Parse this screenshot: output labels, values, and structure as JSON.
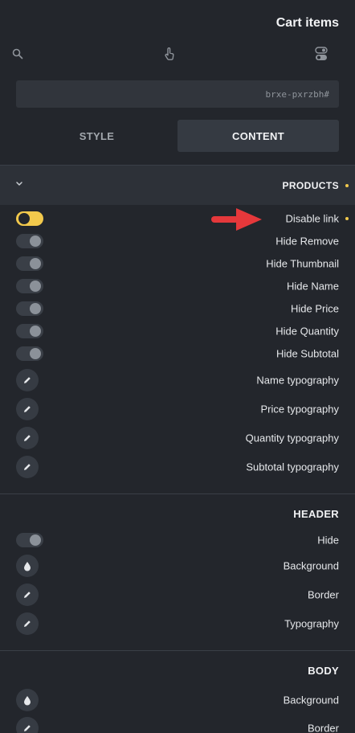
{
  "panel": {
    "title": "Cart items"
  },
  "toolbar": {
    "icons": [
      "search-icon",
      "pointer-icon",
      "toggle-icon"
    ]
  },
  "selector": {
    "value": "brxe-pxrzbh#"
  },
  "tabs": [
    {
      "label": "STYLE",
      "active": false
    },
    {
      "label": "CONTENT",
      "active": true
    }
  ],
  "products": {
    "title": "PRODUCTS",
    "toggles": [
      {
        "label": "Disable link",
        "on": true,
        "modified": true
      },
      {
        "label": "Hide Remove",
        "on": false
      },
      {
        "label": "Hide Thumbnail",
        "on": false
      },
      {
        "label": "Hide Name",
        "on": false
      },
      {
        "label": "Hide Price",
        "on": false
      },
      {
        "label": "Hide Quantity",
        "on": false
      },
      {
        "label": "Hide Subtotal",
        "on": false
      }
    ],
    "typography": [
      {
        "label": "Name typography",
        "icon": "pencil-icon"
      },
      {
        "label": "Price typography",
        "icon": "pencil-icon"
      },
      {
        "label": "Quantity typography",
        "icon": "pencil-icon"
      },
      {
        "label": "Subtotal typography",
        "icon": "pencil-icon"
      }
    ]
  },
  "header": {
    "title": "HEADER",
    "hide": {
      "label": "Hide",
      "on": false
    },
    "background": {
      "label": "Background",
      "icon": "droplet-icon"
    },
    "border": {
      "label": "Border",
      "icon": "pencil-icon"
    },
    "typography": {
      "label": "Typography",
      "icon": "pencil-icon"
    }
  },
  "body": {
    "title": "BODY",
    "background": {
      "label": "Background",
      "icon": "droplet-icon"
    },
    "border": {
      "label": "Border",
      "icon": "pencil-icon"
    }
  },
  "colors": {
    "accent": "#f2c94c",
    "arrow": "#e5383b",
    "background": "#23262c"
  }
}
